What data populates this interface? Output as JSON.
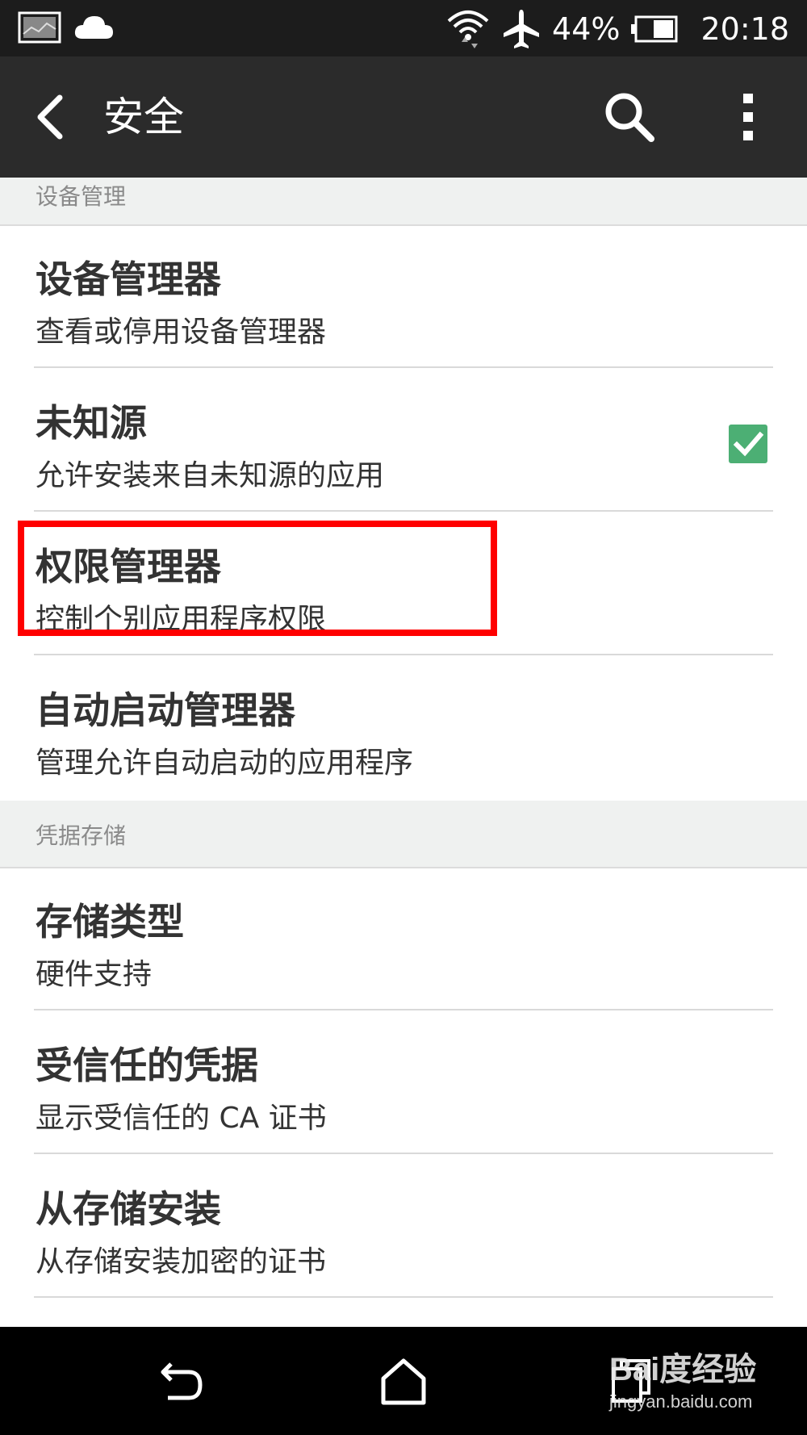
{
  "status_bar": {
    "battery": "44%",
    "time": "20:18"
  },
  "app_bar": {
    "title": "安全"
  },
  "sections": [
    {
      "header": "设备管理",
      "items": [
        {
          "title": "设备管理器",
          "subtitle": "查看或停用设备管理器"
        },
        {
          "title": "未知源",
          "subtitle": "允许安装来自未知源的应用",
          "checked": true
        },
        {
          "title": "权限管理器",
          "subtitle": "控制个别应用程序权限",
          "highlighted": true
        },
        {
          "title": "自动启动管理器",
          "subtitle": "管理允许自动启动的应用程序"
        }
      ]
    },
    {
      "header": "凭据存储",
      "items": [
        {
          "title": "存储类型",
          "subtitle": "硬件支持"
        },
        {
          "title": "受信任的凭据",
          "subtitle": "显示受信任的 CA 证书"
        },
        {
          "title": "从存储安装",
          "subtitle": "从存储安装加密的证书"
        }
      ]
    }
  ],
  "watermark": {
    "line1": "Bai度经验",
    "line2": "jingyan.baidu.com"
  },
  "colors": {
    "checkbox": "#4caf74",
    "highlight": "#ff0000",
    "appbar": "#2b2b2b"
  }
}
